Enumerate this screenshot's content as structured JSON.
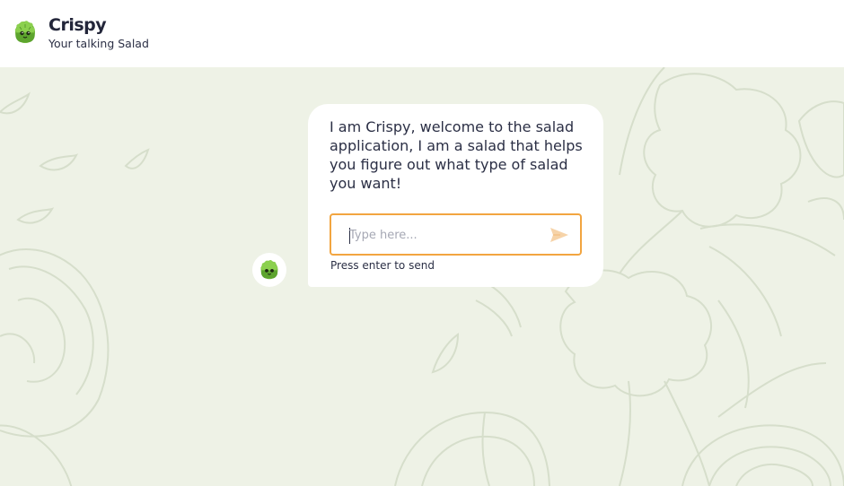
{
  "header": {
    "logo_icon": "lettuce-mascot-icon",
    "title": "Crispy",
    "subtitle": "Your talking Salad"
  },
  "chat": {
    "avatar_icon": "lettuce-mascot-icon",
    "message": "I am Crispy, welcome to the salad application, I am a salad that helps you figure out what type of salad you want!",
    "input_placeholder": "Type here...",
    "input_value": "",
    "send_icon": "send-arrow-icon",
    "hint": "Press enter to send"
  },
  "colors": {
    "background": "#eef2e6",
    "accent": "#f2a540",
    "text": "#2b2f45",
    "mascot_green": "#7cc243"
  }
}
